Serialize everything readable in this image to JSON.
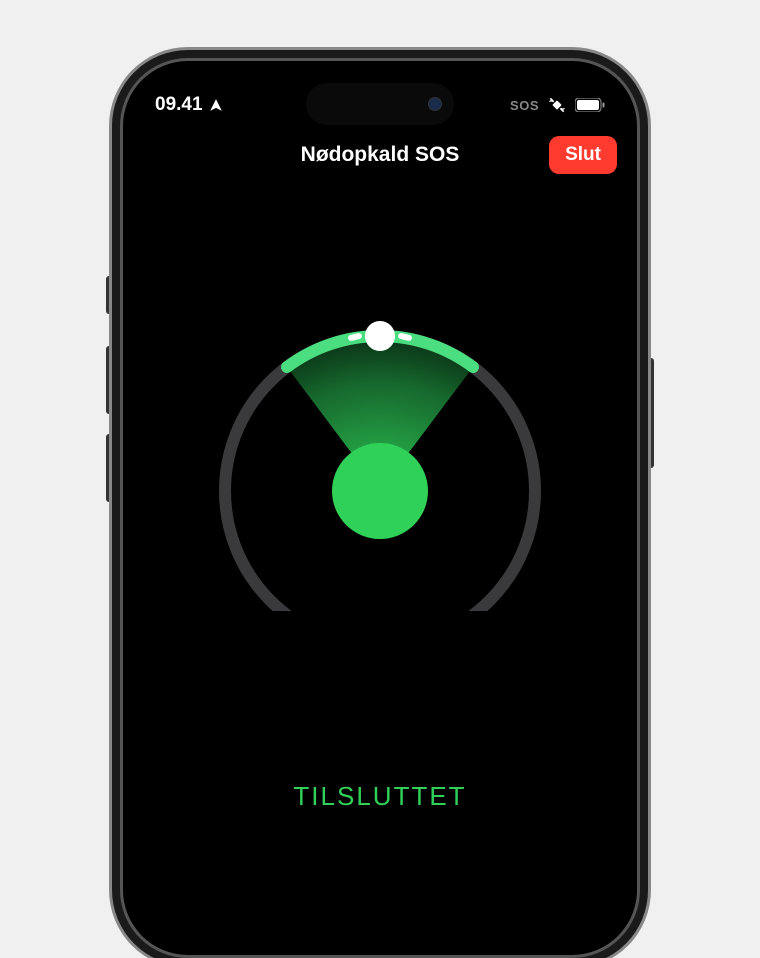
{
  "status_bar": {
    "time": "09.41",
    "sos_label": "SOS"
  },
  "header": {
    "title": "Nødopkald SOS",
    "end_button_label": "Slut"
  },
  "connection": {
    "status_label": "TILSLUTTET"
  },
  "colors": {
    "accent_green": "#30d158",
    "accent_green_bright": "#4ade80",
    "danger_red": "#ff3b30",
    "ring_gray": "#3a3a3c"
  }
}
